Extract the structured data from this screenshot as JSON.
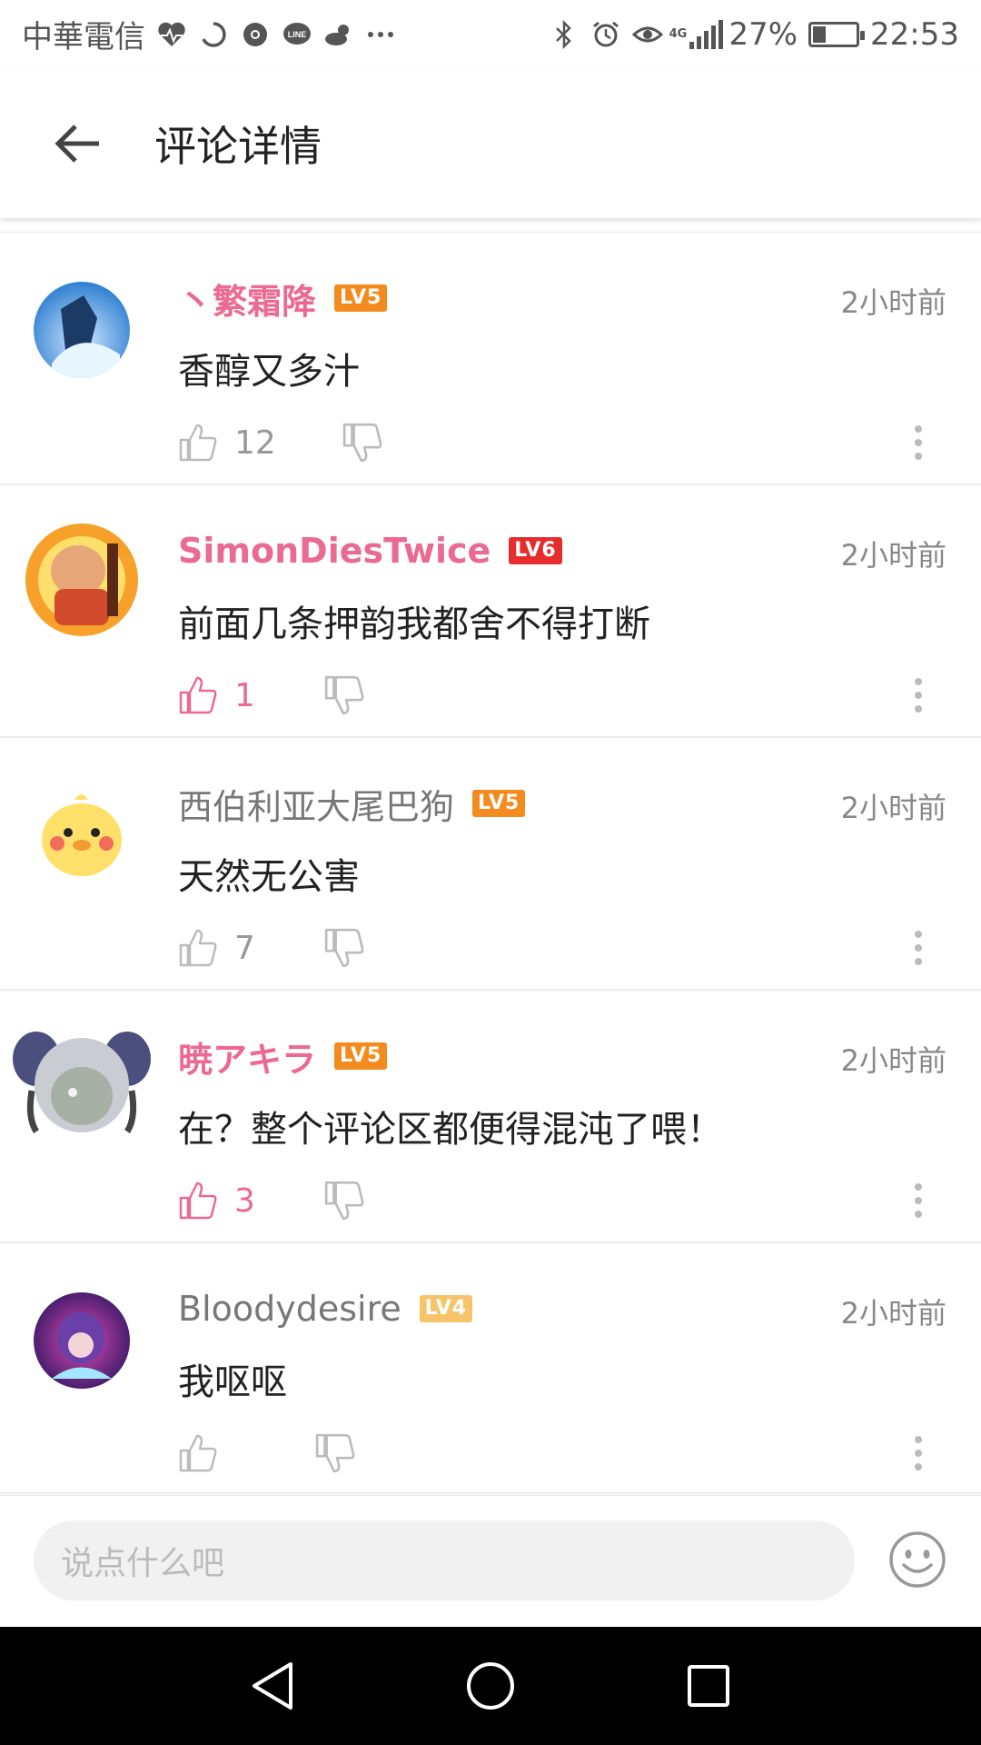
{
  "statusbar": {
    "carrier": "中華電信",
    "battery_text": "27%",
    "battery_level": 0.27,
    "time": "22:53",
    "net_label": "4G",
    "left_icons": [
      "heart-rate-icon",
      "loading-icon",
      "chrome-icon",
      "line-icon",
      "weather-icon",
      "more-dots-icon"
    ],
    "right_icons": [
      "bluetooth-icon",
      "alarm-icon",
      "eye-icon",
      "signal-icon",
      "battery-icon"
    ]
  },
  "header": {
    "title": "评论详情",
    "back_icon": "arrow-left-icon"
  },
  "colors": {
    "pink": "#eb6a92",
    "lv5": "#f38b1f",
    "lv6": "#e52d2d",
    "lv4": "#f7c46c"
  },
  "comments": [
    {
      "username": "丶繁霜降",
      "level": "LV5",
      "time": "2小时前",
      "content": "香醇又多汁",
      "likes": "12",
      "liked": false
    },
    {
      "username": "SimonDiesTwice",
      "level": "LV6",
      "time": "2小时前",
      "content": "前面几条押韵我都舍不得打断",
      "likes": "1",
      "liked": true
    },
    {
      "username": "西伯利亚大尾巴狗",
      "level": "LV5",
      "time": "2小时前",
      "content": "天然无公害",
      "likes": "7",
      "liked": false
    },
    {
      "username": "暁アキラ",
      "level": "LV5",
      "time": "2小时前",
      "content": "在？整个评论区都便得混沌了喂！",
      "likes": "3",
      "liked": true
    },
    {
      "username": "Bloodydesire",
      "level": "LV4",
      "time": "2小时前",
      "content": "我呕呕",
      "likes": "",
      "liked": false
    }
  ],
  "input": {
    "placeholder": "说点什么吧",
    "emoji_icon": "smiley-icon"
  },
  "navbar": {
    "icons": [
      "back-triangle-icon",
      "home-circle-icon",
      "recents-square-icon"
    ]
  }
}
